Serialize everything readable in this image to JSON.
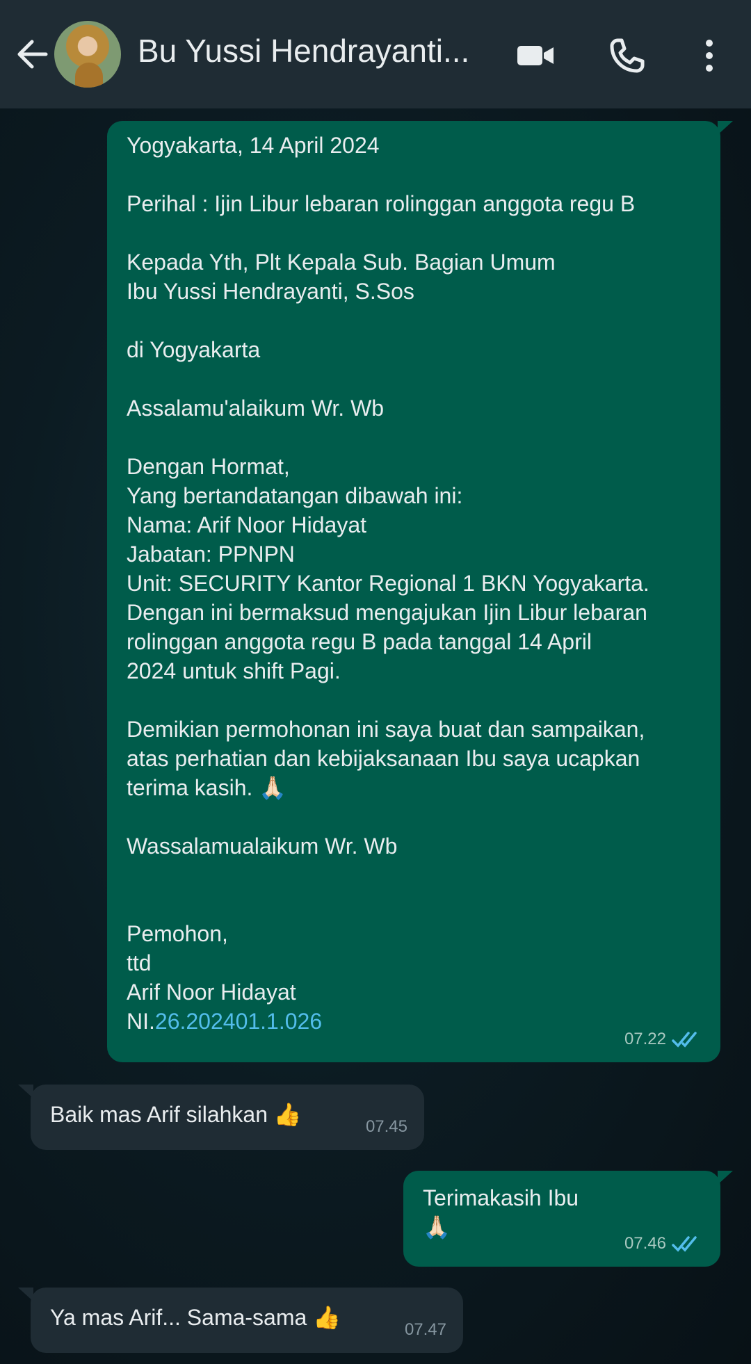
{
  "header": {
    "contact_name": "Bu Yussi Hendrayanti...",
    "icons": [
      "back-arrow-icon",
      "video-call-icon",
      "phone-icon",
      "more-options-icon"
    ]
  },
  "messages": [
    {
      "direction": "outgoing",
      "lines": [
        "Yogyakarta, 14 April 2024",
        "",
        "Perihal : Ijin Libur lebaran rolinggan anggota regu B",
        "",
        "Kepada Yth, Plt Kepala Sub. Bagian Umum",
        "Ibu Yussi Hendrayanti, S.Sos",
        "",
        "di Yogyakarta",
        "",
        "Assalamu'alaikum Wr. Wb",
        "",
        "Dengan Hormat,",
        "Yang bertandatangan dibawah ini:",
        "Nama: Arif Noor Hidayat",
        "Jabatan: PPNPN",
        "Unit: SECURITY Kantor Regional 1 BKN Yogyakarta.",
        "Dengan ini bermaksud mengajukan Ijin Libur lebaran",
        "rolinggan anggota regu B pada tanggal 14 April",
        "2024 untuk shift Pagi.",
        "",
        "Demikian permohonan ini saya buat dan sampaikan,",
        "atas perhatian dan kebijaksanaan Ibu saya ucapkan",
        "terima kasih. 🙏🏻",
        "",
        "Wassalamualaikum Wr. Wb",
        "",
        "",
        "Pemohon,",
        "ttd",
        "Arif Noor Hidayat"
      ],
      "last_line_prefix": "NI.",
      "last_line_link": "26.202401.1.026",
      "time": "07.22",
      "status": "read"
    },
    {
      "direction": "incoming",
      "text": "Baik mas Arif silahkan 👍",
      "time": "07.45"
    },
    {
      "direction": "outgoing",
      "text": "Terimakasih Ibu\n🙏🏻",
      "time": "07.46",
      "status": "read"
    },
    {
      "direction": "incoming",
      "text": "Ya mas Arif... Sama-sama 👍",
      "time": "07.47"
    }
  ],
  "colors": {
    "header_bg": "#1f2c34",
    "outgoing_bubble": "#005c4b",
    "incoming_bubble": "#1f2c34",
    "read_tick": "#53bdeb",
    "link": "#53bdeb"
  }
}
